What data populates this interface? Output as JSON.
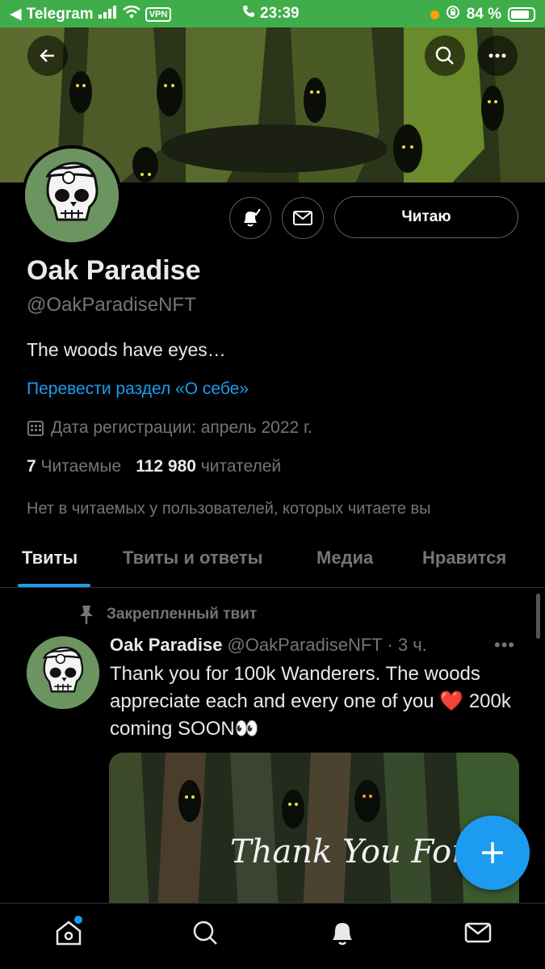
{
  "status_bar": {
    "back_app": "Telegram",
    "vpn": "VPN",
    "time": "23:39",
    "battery": "84 %",
    "battery_level": 0.84
  },
  "profile": {
    "name": "Oak Paradise",
    "handle": "@OakParadiseNFT",
    "bio": "The woods have eyes…",
    "translate_link": "Перевести раздел «О себе»",
    "joined": "Дата регистрации: апрель 2022 г.",
    "following_count": "7",
    "following_label": "Читаемые",
    "followers_count": "112 980",
    "followers_label": "читателей",
    "mutual": "Нет в читаемых у пользователей, которых читаете вы",
    "follow_button": "Читаю"
  },
  "tabs": [
    {
      "label": "Твиты",
      "active": true
    },
    {
      "label": "Твиты и ответы",
      "active": false
    },
    {
      "label": "Медиа",
      "active": false
    },
    {
      "label": "Нравится",
      "active": false
    }
  ],
  "tweet": {
    "pinned_label": "Закрепленный твит",
    "author": "Oak Paradise",
    "meta": "@OakParadiseNFT · 3 ч.",
    "text": "Thank you for 100k Wanderers. The woods appreciate each and every one of you ❤️ 200k coming SOON👀",
    "media_caption": "Thank You For"
  },
  "colors": {
    "accent": "#1d9bf0",
    "status_bar": "#3fae4a",
    "avatar_bg": "#6c9460"
  }
}
